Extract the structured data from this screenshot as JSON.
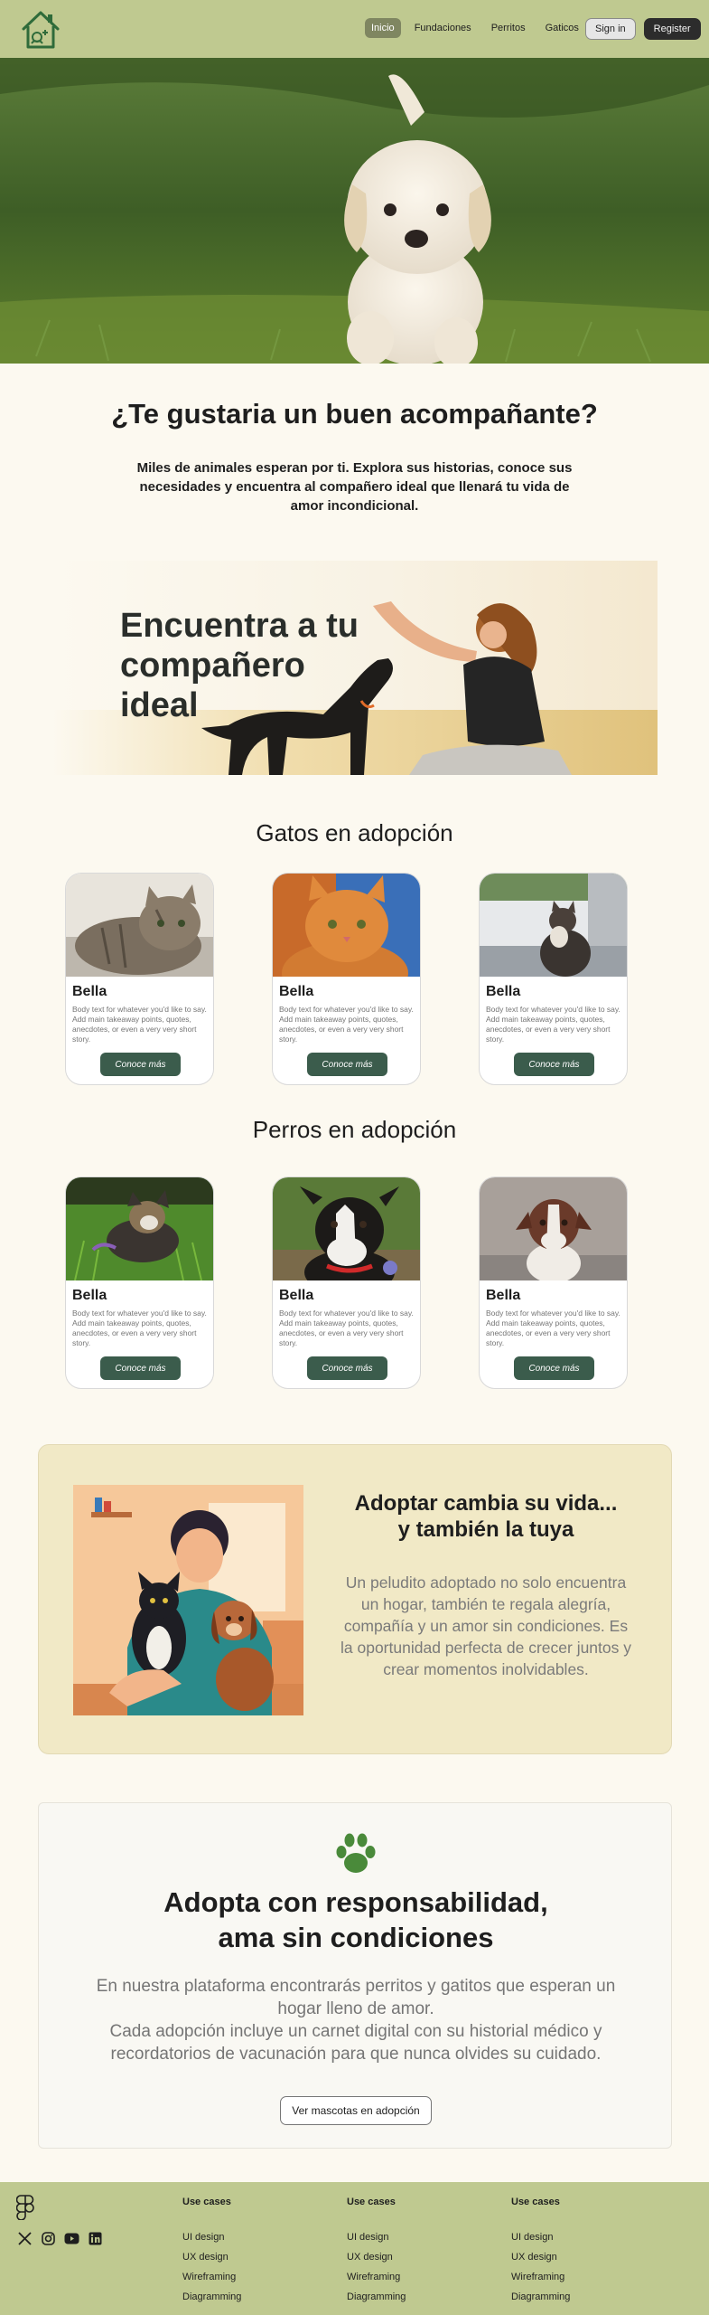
{
  "nav": {
    "items": [
      {
        "label": "Inicio",
        "active": true
      },
      {
        "label": "Fundaciones",
        "active": false
      },
      {
        "label": "Perritos",
        "active": false
      },
      {
        "label": "Gaticos",
        "active": false
      }
    ],
    "signin": "Sign in",
    "register": "Register"
  },
  "intro": {
    "title": "¿Te gustaria un buen acompañante?",
    "text": "Miles de animales esperan por ti. Explora sus historias, conoce sus necesidades y encuentra al compañero ideal que llenará tu vida de amor incondicional."
  },
  "feature": {
    "title": "Encuentra a tu compañero ideal"
  },
  "cats": {
    "title": "Gatos en adopción",
    "cards": [
      {
        "name": "Bella",
        "body": "Body text for whatever you'd like to say. Add main takeaway points, quotes, anecdotes, or even a very very short story.",
        "button": "Conoce más"
      },
      {
        "name": "Bella",
        "body": "Body text for whatever you'd like to say. Add main takeaway points, quotes, anecdotes, or even a very very short story.",
        "button": "Conoce más"
      },
      {
        "name": "Bella",
        "body": "Body text for whatever you'd like to say. Add main takeaway points, quotes, anecdotes, or even a very very short story.",
        "button": "Conoce más"
      }
    ]
  },
  "dogs": {
    "title": "Perros en adopción",
    "cards": [
      {
        "name": "Bella",
        "body": "Body text for whatever you'd like to say. Add main takeaway points, quotes, anecdotes, or even a very very short story.",
        "button": "Conoce más"
      },
      {
        "name": "Bella",
        "body": "Body text for whatever you'd like to say. Add main takeaway points, quotes, anecdotes, or even a very very short story.",
        "button": "Conoce más"
      },
      {
        "name": "Bella",
        "body": "Body text for whatever you'd like to say. Add main takeaway points, quotes, anecdotes, or even a very very short story.",
        "button": "Conoce más"
      }
    ]
  },
  "adopt": {
    "title_line1": "Adoptar cambia su vida...",
    "title_line2": "y también la tuya",
    "text": "Un peludito adoptado no solo encuentra un hogar, también te regala alegría, compañía y un amor sin condiciones. Es la oportunidad perfecta de crecer juntos y crear momentos inolvidables."
  },
  "responsibility": {
    "title_line1": "Adopta con responsabilidad,",
    "title_line2": "ama sin condiciones",
    "text_line1": "En nuestra plataforma encontrarás perritos y gatitos que esperan un hogar lleno de amor.",
    "text_line2": "Cada adopción incluye un carnet digital con su historial médico y recordatorios de vacunación para que nunca olvides su cuidado.",
    "button": "Ver mascotas en adopción"
  },
  "footer": {
    "columns": [
      {
        "title": "Use cases",
        "links": [
          "UI design",
          "UX design",
          "Wireframing",
          "Diagramming"
        ]
      },
      {
        "title": "Use cases",
        "links": [
          "UI design",
          "UX design",
          "Wireframing",
          "Diagramming"
        ]
      },
      {
        "title": "Use cases",
        "links": [
          "UI design",
          "UX design",
          "Wireframing",
          "Diagramming"
        ]
      }
    ],
    "socials": [
      "x-icon",
      "instagram-icon",
      "youtube-icon",
      "linkedin-icon"
    ]
  },
  "colors": {
    "header_bg": "#bfc990",
    "page_bg": "#fcf9f0",
    "button_green": "#3b5c4c",
    "adopt_bg": "#f1e9c6",
    "register_bg": "#2c2c2c"
  }
}
